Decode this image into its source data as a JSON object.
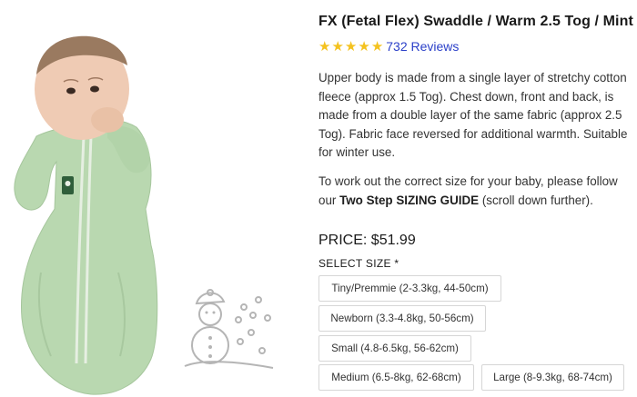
{
  "product": {
    "title": "FX (Fetal Flex) Swaddle / Warm 2.5 Tog / Mint",
    "rating_stars": 5,
    "reviews_label": "732 Reviews",
    "description_1": "Upper body is made from a single layer of stretchy cotton fleece (approx 1.5 Tog). Chest down, front and back, is made from a double layer of the same fabric (approx 2.5 Tog). Fabric face reversed for additional warmth. Suitable for winter use.",
    "description_2_prefix": "To work out the correct size for your baby, please follow our ",
    "description_2_bold": "Two Step SIZING GUIDE",
    "description_2_suffix": " (scroll down further).",
    "price_label": "PRICE: $51.99",
    "size_label": "SELECT SIZE *",
    "sizes": [
      "Tiny/Premmie (2-3.3kg, 44-50cm)",
      "Newborn (3.3-4.8kg, 50-56cm)",
      "Small (4.8-6.5kg, 56-62cm)",
      "Medium (6.5-8kg, 62-68cm)",
      "Large (8-9.3kg, 68-74cm)"
    ]
  },
  "colors": {
    "star": "#f4c21f",
    "link": "#2a3fc8",
    "swaddle": "#b9d8b0",
    "snowman_line": "#b5b5b5"
  },
  "icons": {
    "rating": "star-icon",
    "illustration": "snowman-icon"
  }
}
